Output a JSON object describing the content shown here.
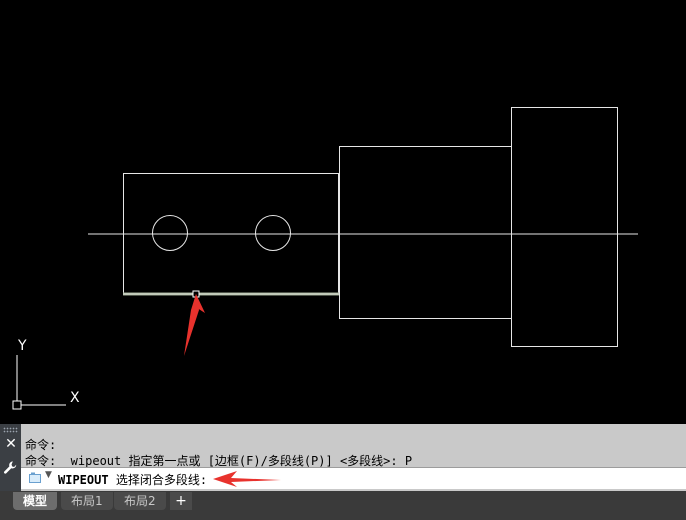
{
  "command_history": [
    "命令:",
    "命令: _wipeout 指定第一点或 [边框(F)/多段线(P)] <多段线>: P"
  ],
  "prompt": {
    "command": "WIPEOUT",
    "text": "选择闭合多段线:"
  },
  "axes": {
    "y_label": "Y",
    "x_label": "X"
  },
  "tabs": [
    "模型",
    "布局1",
    "布局2"
  ],
  "active_tab": "模型",
  "add_tab_label": "+",
  "colors": {
    "canvas_bg": "#000000",
    "drawing_lines": "#ffffff",
    "annotation_arrow": "#e8322d",
    "command_bg": "#c9c9c9"
  },
  "icons": [
    "close-icon",
    "wrench-icon",
    "command-icon",
    "chevron-down-icon",
    "ucs-icon",
    "grip-icon"
  ]
}
